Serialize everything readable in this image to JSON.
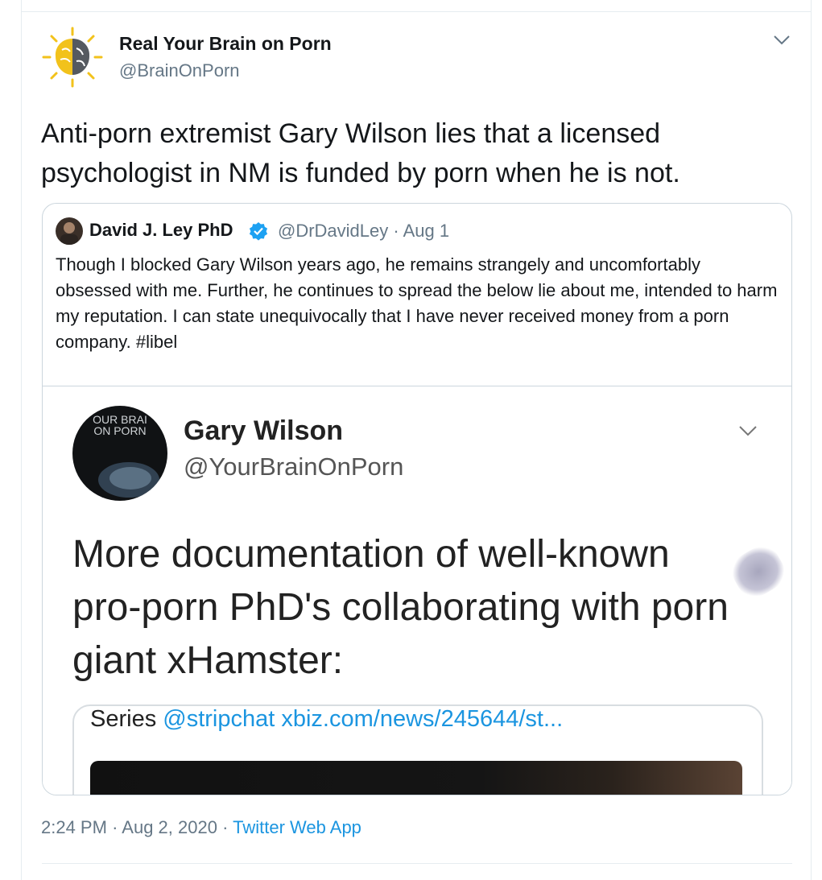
{
  "tweet": {
    "author_name": "Real Your Brain on Porn",
    "author_handle": "@BrainOnPorn",
    "text": "Anti-porn extremist Gary Wilson lies that a licensed psychologist in NM is funded by porn when he is not.",
    "time": "2:24 PM",
    "date": "Aug 2, 2020",
    "separator": "·",
    "source": "Twitter Web App"
  },
  "quoted": {
    "author_name": "David J. Ley PhD",
    "verified_icon": "verified-badge-icon",
    "handle_date": "@DrDavidLey · Aug 1",
    "text": "Though I blocked Gary Wilson years ago, he remains strangely and uncomfortably obsessed with me. Further, he continues to spread the below lie about me, intended to harm my reputation. I can state unequivocally that I have never received money from a porn company. #libel"
  },
  "media": {
    "author_name": "Gary Wilson",
    "author_handle": "@YourBrainOnPorn",
    "avatar_line1": "OUR BRAI",
    "avatar_line2": "ON PORN",
    "text": "More documentation of well-known pro-porn PhD's collaborating with porn giant xHamster:",
    "link_prefix": "Series",
    "link_text": "@stripchat xbiz.com/news/245644/st..."
  },
  "colors": {
    "link": "#1b95e0",
    "secondary_text": "#657786",
    "border": "#ccd6dd"
  }
}
